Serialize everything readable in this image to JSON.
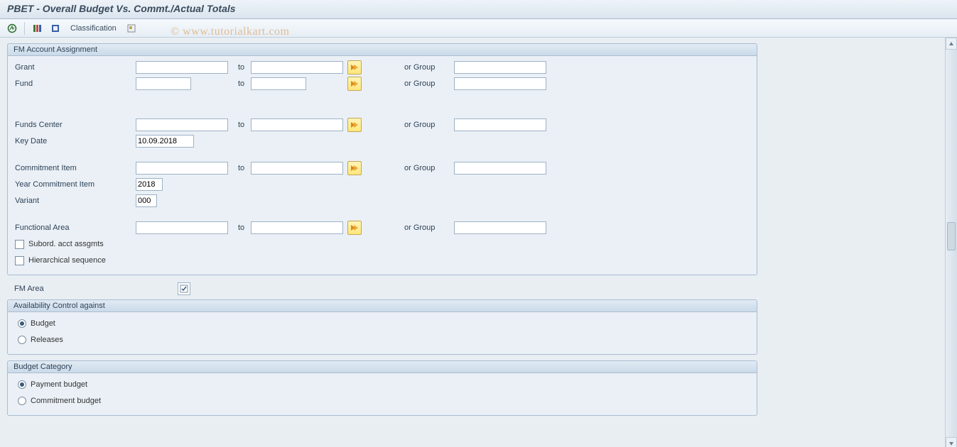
{
  "title": "PBET - Overall Budget Vs. Commt./Actual Totals",
  "watermark": "© www.tutorialkart.com",
  "toolbar": {
    "classification_label": "Classification"
  },
  "frames": {
    "fm_acct": {
      "title": "FM Account Assignment",
      "rows": {
        "grant": {
          "label": "Grant",
          "from": "",
          "to_label": "to",
          "to": "",
          "or_group_label": "or Group",
          "group": ""
        },
        "fund": {
          "label": "Fund",
          "from": "",
          "to_label": "to",
          "to": "",
          "or_group_label": "or Group",
          "group": ""
        },
        "funds_center": {
          "label": "Funds Center",
          "from": "",
          "to_label": "to",
          "to": "",
          "or_group_label": "or Group",
          "group": ""
        },
        "key_date": {
          "label": "Key Date",
          "value": "10.09.2018"
        },
        "commit_item": {
          "label": "Commitment Item",
          "from": "",
          "to_label": "to",
          "to": "",
          "or_group_label": "or Group",
          "group": ""
        },
        "year_ci": {
          "label": "Year Commitment Item",
          "value": "2018"
        },
        "variant": {
          "label": "Variant",
          "value": "000"
        },
        "func_area": {
          "label": "Functional Area",
          "from": "",
          "to_label": "to",
          "to": "",
          "or_group_label": "or Group",
          "group": ""
        }
      },
      "checkboxes": {
        "subord": {
          "label": "Subord. acct assgmts",
          "checked": false
        },
        "hier": {
          "label": "Hierarchical sequence",
          "checked": false
        }
      }
    },
    "fm_area": {
      "label": "FM Area"
    },
    "avail": {
      "title": "Availability Control against",
      "options": {
        "budget": {
          "label": "Budget",
          "checked": true
        },
        "releases": {
          "label": "Releases",
          "checked": false
        }
      }
    },
    "budget_cat": {
      "title": "Budget Category",
      "options": {
        "payment": {
          "label": "Payment budget",
          "checked": true
        },
        "commitment": {
          "label": "Commitment budget",
          "checked": false
        }
      }
    }
  }
}
